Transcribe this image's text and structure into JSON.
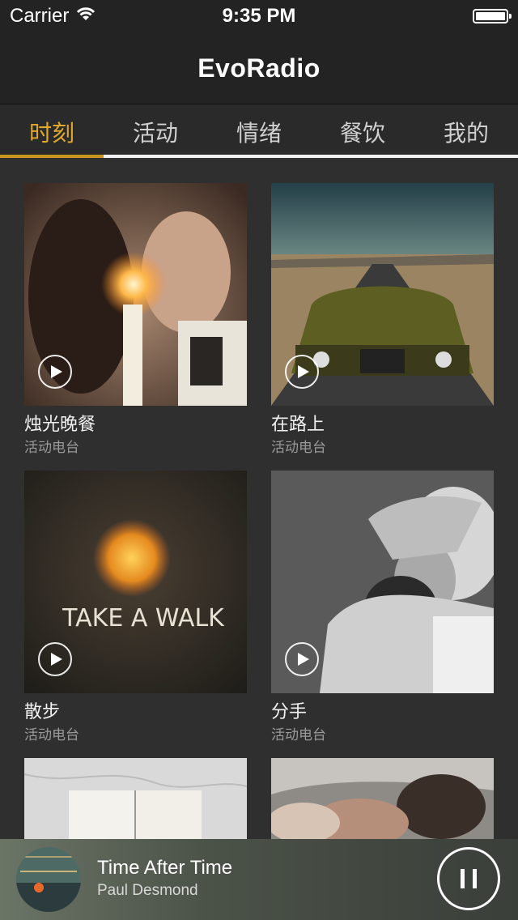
{
  "status_bar": {
    "carrier": "Carrier",
    "time": "9:35 PM"
  },
  "nav": {
    "title": "EvoRadio"
  },
  "tabs": [
    {
      "label": "时刻",
      "active": true
    },
    {
      "label": "活动",
      "active": false
    },
    {
      "label": "情绪",
      "active": false
    },
    {
      "label": "餐饮",
      "active": false
    },
    {
      "label": "我的",
      "active": false
    }
  ],
  "cards": [
    {
      "title": "烛光晚餐",
      "subtitle": "活动电台",
      "image": "candlelight-couple-photo"
    },
    {
      "title": "在路上",
      "subtitle": "活动电台",
      "image": "vintage-car-road-photo"
    },
    {
      "title": "散步",
      "subtitle": "活动电台",
      "image": "take-a-walk-art",
      "image_text": "TAKE A WALK"
    },
    {
      "title": "分手",
      "subtitle": "活动电台",
      "image": "embracing-couple-bw-photo"
    },
    {
      "title": "",
      "subtitle": "",
      "image": "open-book-marble-photo"
    },
    {
      "title": "",
      "subtitle": "",
      "image": "couple-bathtub-photo"
    }
  ],
  "player": {
    "track_title": "Time After Time",
    "artist": "Paul Desmond",
    "album_art": "jazz-album-cover",
    "state": "playing"
  },
  "colors": {
    "accent": "#c8961e",
    "background": "#2f2f2f",
    "bar": "#232323"
  }
}
